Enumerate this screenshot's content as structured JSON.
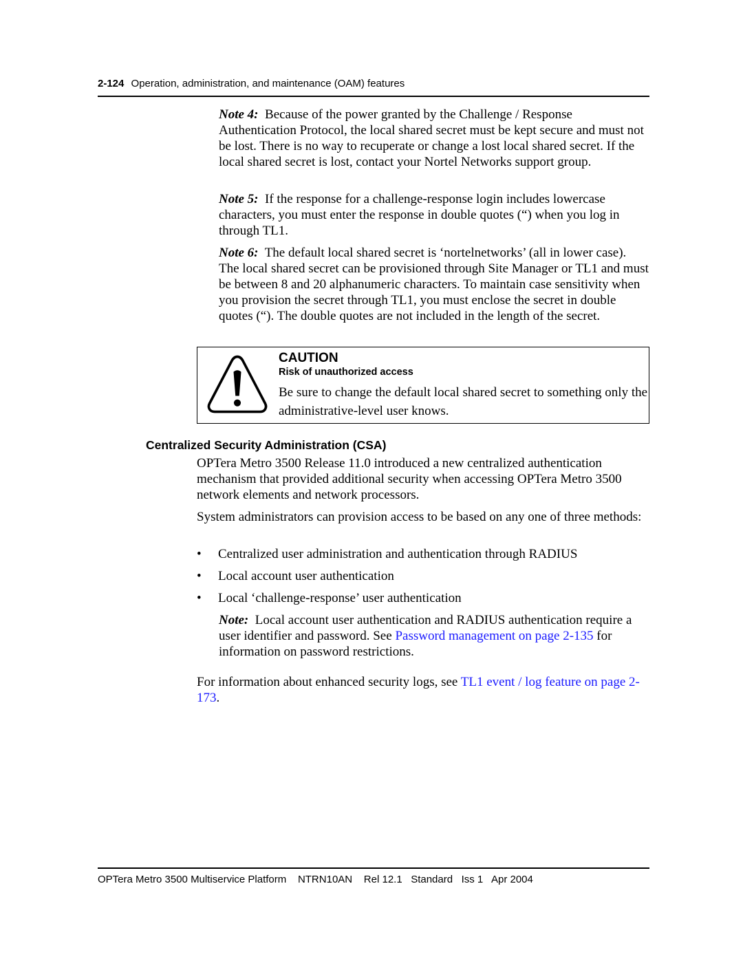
{
  "header": {
    "page_number": "2-124",
    "section_title": "Operation, administration, and maintenance (OAM) features"
  },
  "notes": [
    {
      "label": "Note 4:",
      "text": "Because of the power granted by the Challenge / Response Authentication Protocol, the local shared secret must be kept secure and must not be lost. There is no way to recuperate or change a lost local shared secret. If the local shared secret is lost, contact your Nortel Networks support group."
    },
    {
      "label": "Note 5:",
      "text": "If the response for a challenge-response login includes lowercase characters, you must enter the response in double quotes (“) when you log in through TL1."
    },
    {
      "label": "Note 6:",
      "text": "The default local shared secret is ‘nortelnetworks’ (all in lower case). The local shared secret can be provisioned through Site Manager or TL1 and must be between 8 and 20 alphanumeric characters. To maintain case sensitivity when you provision the secret through TL1, you must enclose the secret in double quotes (“). The double quotes are not included in the length of the secret."
    }
  ],
  "caution": {
    "icon": "warning-triangle-icon",
    "title": "CAUTION",
    "subtitle": "Risk of unauthorized access",
    "body": "Be sure to change the default local shared secret to something only the administrative-level user knows."
  },
  "csa": {
    "heading": "Centralized Security Administration (CSA)",
    "intro": "OPTera Metro 3500 Release 11.0 introduced a new centralized authentication mechanism that provided additional security when accessing OPTera Metro 3500 network elements and network processors.",
    "methods_intro": "System administrators can provision access to be based on any one of three methods:",
    "bullets": [
      "Centralized user administration and authentication through RADIUS",
      "Local account user authentication",
      "Local ‘challenge-response’ user authentication"
    ],
    "note": {
      "label": "Note:",
      "text_before": "Local account user authentication and RADIUS authentication require a user identifier and password. See ",
      "link": "Password management on page 2-135",
      "text_after": " for information on password restrictions."
    },
    "logs": {
      "text_before": "For information about enhanced security logs, see ",
      "link": "TL1 event / log feature on page 2-173",
      "text_after": "."
    }
  },
  "footer": {
    "product": "OPTera Metro 3500 Multiservice Platform",
    "doc_id": "NTRN10AN",
    "release": "Rel 12.1",
    "status": "Standard",
    "issue": "Iss 1",
    "date": "Apr 2004"
  }
}
